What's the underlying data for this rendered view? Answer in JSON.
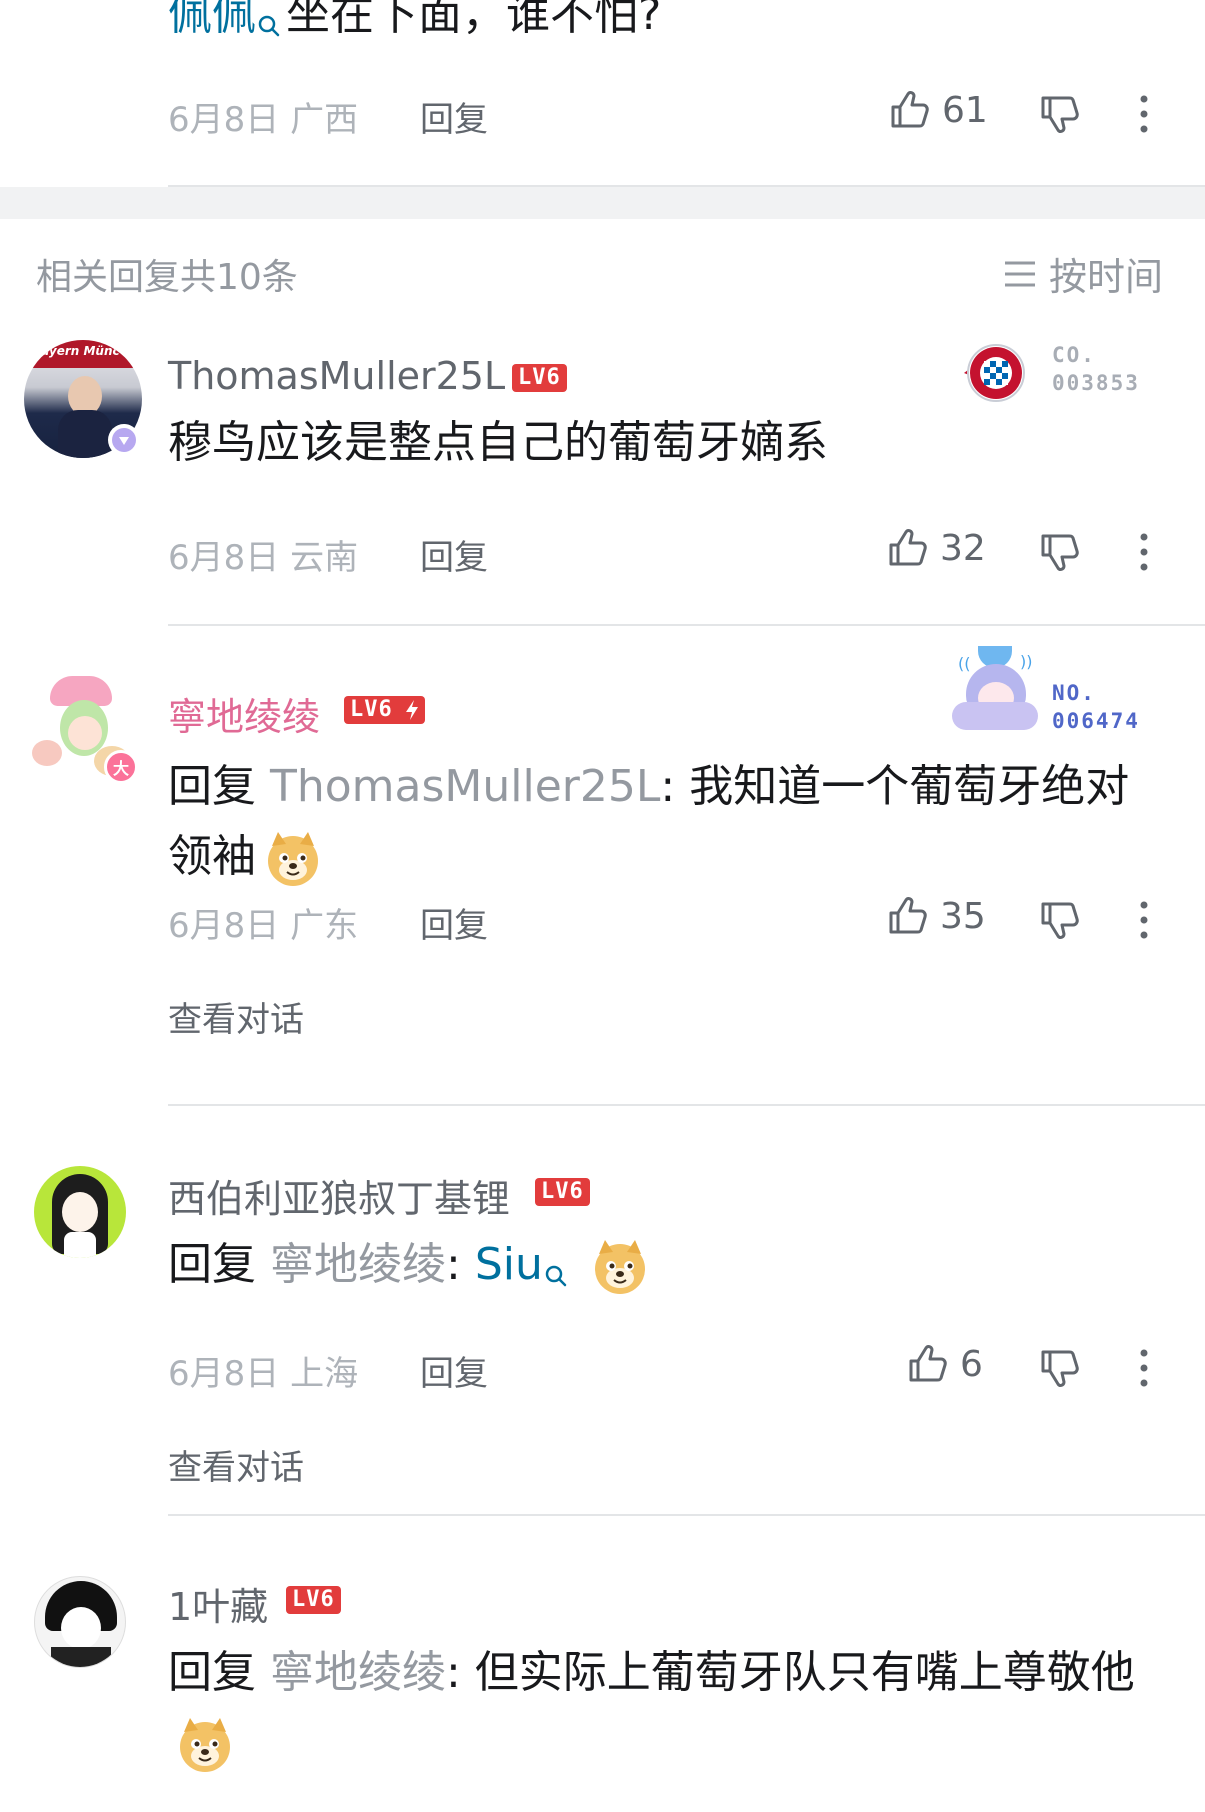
{
  "top_comment": {
    "text_user": "佩佩",
    "text": "坐在下面，谁不怕?",
    "date": "6月8日",
    "region": "广西",
    "reply_label": "回复",
    "likes": "61"
  },
  "section": {
    "title": "相关回复共10条",
    "sort_label": "按时间"
  },
  "replies": [
    {
      "username": "ThomasMuller25L",
      "level": "LV6",
      "fan_badge_line1": "CO.",
      "fan_badge_line2": "003853",
      "content": "穆鸟应该是整点自己的葡萄牙嫡系",
      "date": "6月8日",
      "region": "云南",
      "reply_label": "回复",
      "likes": "32"
    },
    {
      "username": "寧地绫绫",
      "level": "LV6",
      "fan_badge_line1": "NO.",
      "fan_badge_line2": "006474",
      "reply_prefix": "回复",
      "reply_to": "ThomasMuller25L",
      "content": ": 我知道一个葡萄牙绝对领袖",
      "date": "6月8日",
      "region": "广东",
      "reply_label": "回复",
      "likes": "35",
      "view_conversation": "查看对话"
    },
    {
      "username": "西伯利亚狼叔丁基锂",
      "level": "LV6",
      "reply_prefix": "回复",
      "reply_to": "寧地绫绫",
      "content_sep": ": ",
      "link_text": "Siu",
      "date": "6月8日",
      "region": "上海",
      "reply_label": "回复",
      "likes": "6",
      "view_conversation": "查看对话"
    },
    {
      "username": "1叶藏",
      "level": "LV6",
      "reply_prefix": "回复",
      "reply_to": "寧地绫绫",
      "content": ": 但实际上葡萄牙队只有嘴上尊敬他"
    }
  ],
  "colors": {
    "accent_pink": "#e06a95",
    "level_red": "#e23c3c",
    "link_blue": "#00709e",
    "fan_blue": "#5067c8"
  },
  "icons": [
    "search-icon",
    "thumb-up-icon",
    "thumb-down-icon",
    "more-icon",
    "sort-icon",
    "doge-emoji",
    "lightning-icon"
  ]
}
